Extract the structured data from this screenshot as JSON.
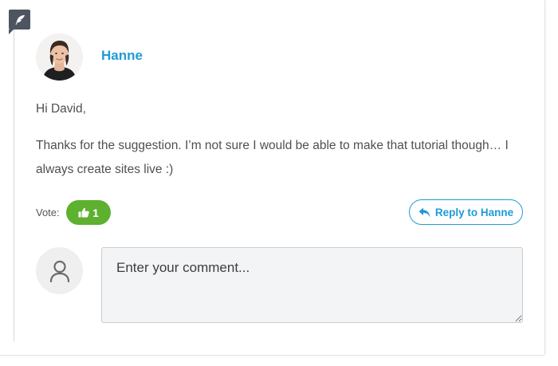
{
  "comment": {
    "author": "Hanne",
    "paragraphs": [
      "Hi David,",
      "Thanks for the suggestion. I’m not sure I would be able to make that tutorial though… I always create sites live :)"
    ]
  },
  "actions": {
    "vote_label": "Vote:",
    "vote_count": "1",
    "reply_label": "Reply to Hanne"
  },
  "reply_form": {
    "placeholder": "Enter your comment..."
  },
  "icons": {
    "edit": "feather-icon",
    "vote": "thumbs-up-icon",
    "reply": "reply-arrow-icon",
    "user": "user-icon"
  },
  "colors": {
    "accent": "#1e9bd7",
    "vote_green": "#5db12f",
    "badge": "#4e5560"
  }
}
